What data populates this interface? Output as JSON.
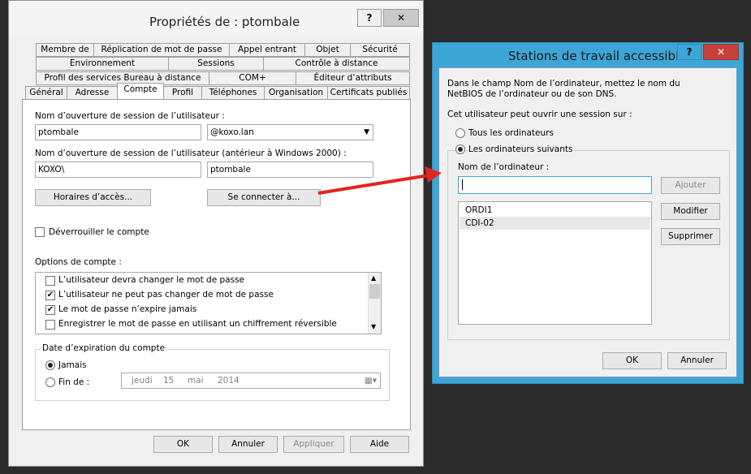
{
  "props": {
    "title": "Propriétés de : ptombale",
    "help_btn": "?",
    "close_btn": "✕",
    "tabs_row1": [
      "Membre de",
      "Réplication de mot de passe",
      "Appel entrant",
      "Objet",
      "Sécurité"
    ],
    "tabs_row2": [
      "Environnement",
      "Sessions",
      "Contrôle à distance"
    ],
    "tabs_row3": [
      "Profil des services Bureau à distance",
      "COM+",
      "Éditeur d’attributs"
    ],
    "tabs_row4": [
      "Général",
      "Adresse",
      "Compte",
      "Profil",
      "Téléphones",
      "Organisation",
      "Certificats publiés"
    ],
    "logon_label": "Nom d’ouverture de session de l’utilisateur :",
    "logon_value": "ptombale",
    "domain_value": "@koxo.lan",
    "logon2000_label": "Nom d’ouverture de session de l’utilisateur (antérieur à Windows 2000) :",
    "domain2000_value": "KOXO\\",
    "logon2000_value": "ptombale",
    "hours_btn": "Horaires d’accès...",
    "connect_btn": "Se connecter à...",
    "unlock_label": "Déverrouiller le compte",
    "options_label": "Options de compte :",
    "options": [
      {
        "label": "L’utilisateur devra changer le mot de passe",
        "checked": ""
      },
      {
        "label": "L’utilisateur ne peut pas changer de mot de passe",
        "checked": "✔"
      },
      {
        "label": "Le mot de passe n’expire jamais",
        "checked": "✔"
      },
      {
        "label": "Enregistrer le mot de passe en utilisant un chiffrement réversible",
        "checked": ""
      }
    ],
    "expiry_label": "Date d’expiration du compte",
    "never_label": "Jamais",
    "end_label": "Fin de :",
    "date_day": "jeudi",
    "date_num": "15",
    "date_month": "mai",
    "date_year": "2014",
    "ok": "OK",
    "cancel": "Annuler",
    "apply": "Appliquer",
    "help": "Aide"
  },
  "stations": {
    "title": "Stations de travail accessibles",
    "help_btn": "?",
    "close_btn": "✕",
    "description": "Dans le champ Nom de l’ordinateur, mettez le nom du NetBIOS de l’ordinateur ou de son DNS.",
    "can_login_label": "Cet utilisateur peut ouvrir une session sur :",
    "all_label": "Tous les ordinateurs",
    "following_label": "Les ordinateurs suivants",
    "computer_name_label": "Nom de l’ordinateur :",
    "computer_name_value": "",
    "add_btn": "Ajouter",
    "modify_btn": "Modifier",
    "remove_btn": "Supprimer",
    "computers": [
      "ORDI1",
      "CDI-02"
    ],
    "ok": "OK",
    "cancel": "Annuler"
  },
  "colors": {
    "accent": "#3ea6d6",
    "close_red": "#c7403a",
    "arrow": "#e0261f"
  }
}
